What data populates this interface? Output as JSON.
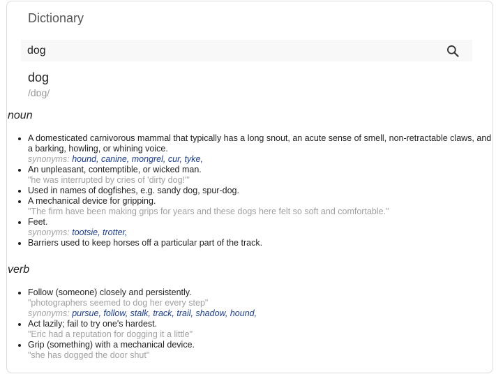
{
  "app": {
    "title": "Dictionary"
  },
  "search": {
    "value": "dog",
    "icon": "search-icon"
  },
  "entry": {
    "headword": "dog",
    "phonetic": "/dɒg/",
    "groups": [
      {
        "pos": "noun",
        "senses": [
          {
            "def": "A domesticated carnivorous mammal that typically has a long snout, an acute sense of smell, non-retractable claws, and a barking, howling, or whining voice.",
            "synonyms_label": "synonyms:",
            "synonyms": [
              "hound,",
              "canine,",
              "mongrel,",
              "cur,",
              "tyke,"
            ]
          },
          {
            "def": "An unpleasant, contemptible, or wicked man.",
            "example": "\"he was interrupted by cries of 'dirty dog!'\""
          },
          {
            "def": "Used in names of dogfishes, e.g. sandy dog, spur-dog."
          },
          {
            "def": "A mechanical device for gripping.",
            "example": "\"The firm have been making grips for years and these dogs here felt so soft and comfortable.\""
          },
          {
            "def": "Feet.",
            "synonyms_label": "synonyms:",
            "synonyms": [
              "tootsie,",
              "trotter,"
            ]
          },
          {
            "def": "Barriers used to keep horses off a particular part of the track."
          }
        ]
      },
      {
        "pos": "verb",
        "senses": [
          {
            "def": "Follow (someone) closely and persistently.",
            "example": "\"photographers seemed to dog her every step\"",
            "synonyms_label": "synonyms:",
            "synonyms": [
              "pursue,",
              "follow,",
              "stalk,",
              "track,",
              "trail,",
              "shadow,",
              "hound,"
            ]
          },
          {
            "def": "Act lazily; fail to try one's hardest.",
            "example": "\"Eric had a reputation for dogging it a little\""
          },
          {
            "def": "Grip (something) with a mechanical device.",
            "example": "\"she has dogged the door shut\""
          }
        ]
      }
    ]
  },
  "colors": {
    "synonym": "#1a3c8c",
    "muted": "#a0a0a0",
    "border": "#dcdcdc"
  }
}
